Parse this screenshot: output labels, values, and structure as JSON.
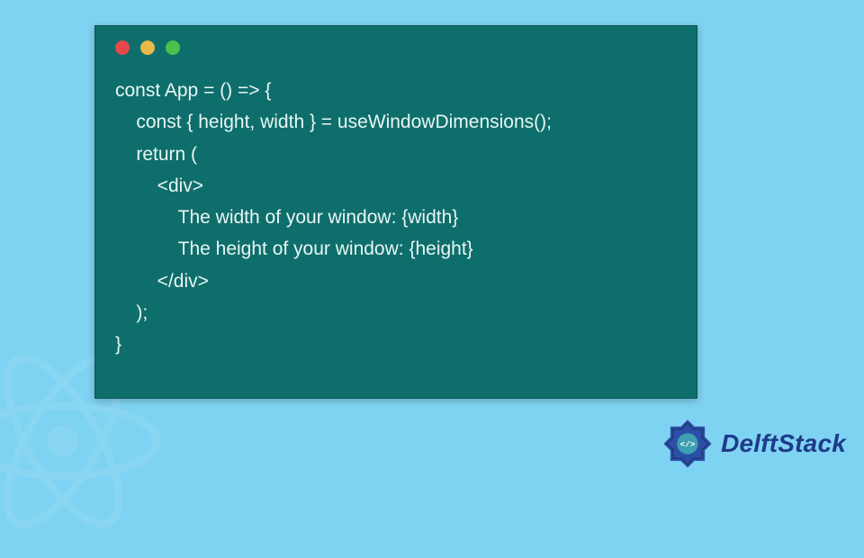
{
  "window": {
    "dots": [
      "red",
      "yellow",
      "green"
    ]
  },
  "code": {
    "lines": [
      "const App = () => {",
      "    const { height, width } = useWindowDimensions();",
      "    return (",
      "        <div>",
      "            The width of your window: {width}",
      "            The height of your window: {height}",
      "        </div>",
      "    );",
      "}"
    ]
  },
  "brand": {
    "name": "DelftStack",
    "logo_color": "#2B4FA8",
    "logo_accent": "#3CA0B0"
  },
  "background_icon": "react-logo"
}
